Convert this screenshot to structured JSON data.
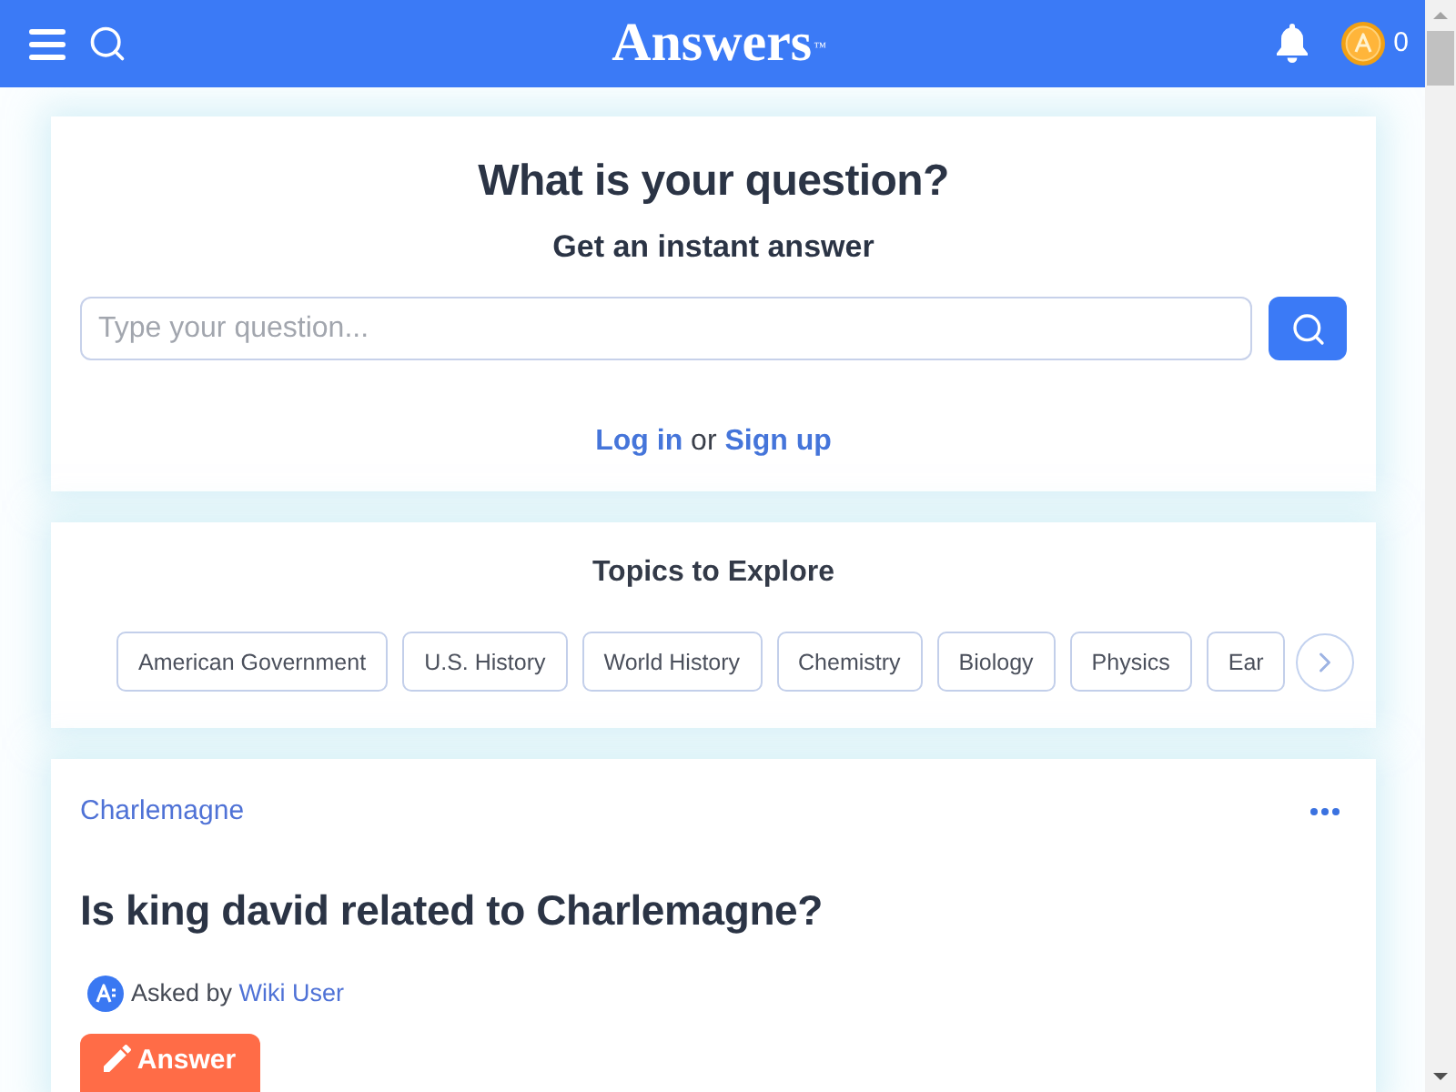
{
  "header": {
    "logo": "Answers$^{™}$",
    "coins": "0"
  },
  "ask": {
    "title": "What is your question?",
    "subtitle": "Get an instant answer",
    "search": {
      "placeholder": "Type your question..."
    },
    "auth": {
      "login": "Log in",
      "joiner": "or",
      "signup": "Sign up"
    }
  },
  "topics": {
    "title": "Topics to Explore",
    "items": [
      "American Government",
      "U.S. History",
      "World History",
      "Chemistry",
      "Biology",
      "Physics",
      "Ear"
    ]
  },
  "question": {
    "topic": "Charlemagne",
    "title": "Is king david related to Charlemagne?",
    "asked_by": "Asked by",
    "author": "Wiki User",
    "answer_button": "Answer"
  }
}
